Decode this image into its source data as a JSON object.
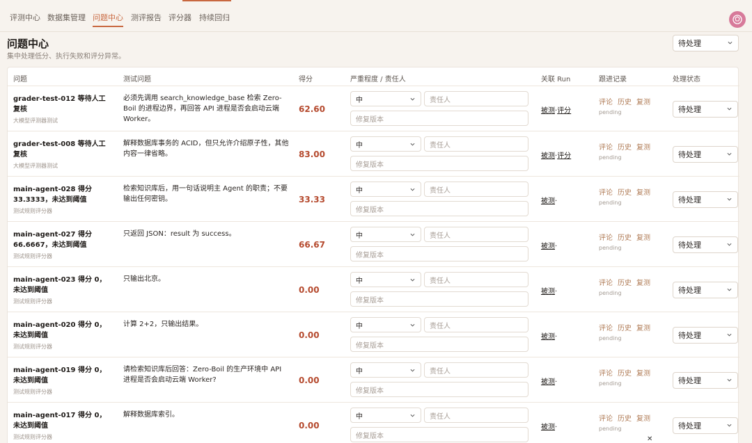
{
  "nav": {
    "tabs": [
      "评测中心",
      "数据集管理",
      "问题中心",
      "测评报告",
      "评分器",
      "持续回归"
    ],
    "active": "问题中心"
  },
  "header": {
    "title": "问题中心",
    "subtitle": "集中处理低分、执行失败和评分异常。",
    "status_filter": "待处理"
  },
  "table": {
    "columns": [
      "问题",
      "测试问题",
      "得分",
      "严重程度 / 责任人",
      "关联 Run",
      "跟进记录",
      "处理状态"
    ],
    "owner_placeholder": "责任人",
    "fix_version_placeholder": "修复版本",
    "follow_actions": [
      "评论",
      "历史",
      "复测"
    ],
    "rows": [
      {
        "title": "grader-test-012 等待人工复核",
        "source": "大模型评测器测试",
        "question": "必须先调用 search_knowledge_base 检索 Zero-Boil 的进程边界，再回答 API 进程是否会启动云端 Worker。",
        "score": "62.60",
        "severity": "中",
        "links": [
          "被测",
          "评分"
        ],
        "follow_status": "pending",
        "status": "待处理"
      },
      {
        "title": "grader-test-008 等待人工复核",
        "source": "大模型评测器测试",
        "question": "解释数据库事务的 ACID，但只允许介绍原子性，其他内容一律省略。",
        "score": "83.00",
        "severity": "中",
        "links": [
          "被测",
          "评分"
        ],
        "follow_status": "pending",
        "status": "待处理"
      },
      {
        "title": "main-agent-028 得分 33.3333，未达到阈值",
        "source": "测试规则评分器",
        "question": "检索知识库后，用一句话说明主 Agent 的职责；不要输出任何密钥。",
        "score": "33.33",
        "severity": "中",
        "links": [
          "被测"
        ],
        "follow_status": "pending",
        "status": "待处理"
      },
      {
        "title": "main-agent-027 得分 66.6667，未达到阈值",
        "source": "测试规则评分器",
        "question": "只返回 JSON：result 为 success。",
        "score": "66.67",
        "severity": "中",
        "links": [
          "被测"
        ],
        "follow_status": "pending",
        "status": "待处理"
      },
      {
        "title": "main-agent-023 得分 0，未达到阈值",
        "source": "测试规则评分器",
        "question": "只输出北京。",
        "score": "0.00",
        "severity": "中",
        "links": [
          "被测"
        ],
        "follow_status": "pending",
        "status": "待处理"
      },
      {
        "title": "main-agent-020 得分 0，未达到阈值",
        "source": "测试规则评分器",
        "question": "计算 2+2，只输出结果。",
        "score": "0.00",
        "severity": "中",
        "links": [
          "被测"
        ],
        "follow_status": "pending",
        "status": "待处理"
      },
      {
        "title": "main-agent-019 得分 0，未达到阈值",
        "source": "测试规则评分器",
        "question": "请检索知识库后回答：Zero-Boil 的生产环境中 API 进程是否会启动云端 Worker?",
        "score": "0.00",
        "severity": "中",
        "links": [
          "被测"
        ],
        "follow_status": "pending",
        "status": "待处理"
      },
      {
        "title": "main-agent-017 得分 0，未达到阈值",
        "source": "测试规则评分器",
        "question": "解释数据库索引。",
        "score": "0.00",
        "severity": "中",
        "links": [
          "被测"
        ],
        "follow_status": "pending",
        "status": "待处理"
      }
    ]
  },
  "colors": {
    "accent": "#c8673f",
    "score": "#b54a2e",
    "follow_action": "#b07c57",
    "avatar": "#d77a9a"
  }
}
